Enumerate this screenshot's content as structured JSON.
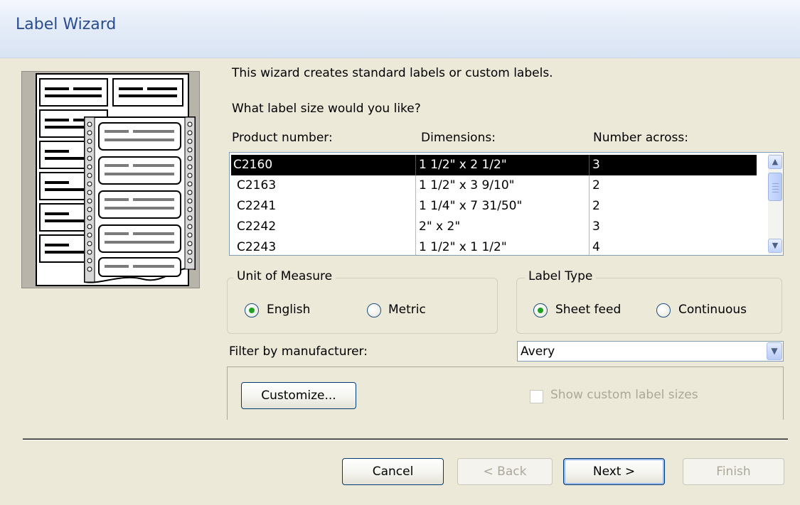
{
  "window": {
    "title": "Label Wizard"
  },
  "intro": {
    "line1": "This wizard creates standard labels or custom labels.",
    "line2": "What label size would you like?"
  },
  "list": {
    "headers": [
      "Product number:",
      "Dimensions:",
      "Number across:"
    ],
    "rows": [
      {
        "product": "C2160",
        "dimensions": "1 1/2\" x 2 1/2\"",
        "across": "3",
        "selected": true
      },
      {
        "product": "C2163",
        "dimensions": "1 1/2\" x 3 9/10\"",
        "across": "2"
      },
      {
        "product": "C2241",
        "dimensions": "1 1/4\" x 7 31/50\"",
        "across": "2"
      },
      {
        "product": "C2242",
        "dimensions": "2\" x 2\"",
        "across": "3"
      },
      {
        "product": "C2243",
        "dimensions": "1 1/2\" x 1 1/2\"",
        "across": "4"
      }
    ]
  },
  "unit_of_measure": {
    "legend": "Unit of Measure",
    "options": [
      {
        "label": "English",
        "checked": true
      },
      {
        "label": "Metric",
        "checked": false
      }
    ]
  },
  "label_type": {
    "legend": "Label Type",
    "options": [
      {
        "label": "Sheet feed",
        "checked": true
      },
      {
        "label": "Continuous",
        "checked": false
      }
    ]
  },
  "filter": {
    "label": "Filter by  manufacturer:",
    "value": "Avery"
  },
  "custom": {
    "customize_button": "Customize...",
    "show_custom_label": "Show custom label sizes",
    "show_custom_checked": false
  },
  "footer": {
    "cancel": "Cancel",
    "back": "< Back",
    "next": "Next >",
    "finish": "Finish"
  },
  "colors": {
    "title_text": "#294c8e",
    "dialog_bg": "#ece9d8",
    "selection_bg": "#000000",
    "radio_dot": "#21a121",
    "button_border": "#003c74"
  }
}
